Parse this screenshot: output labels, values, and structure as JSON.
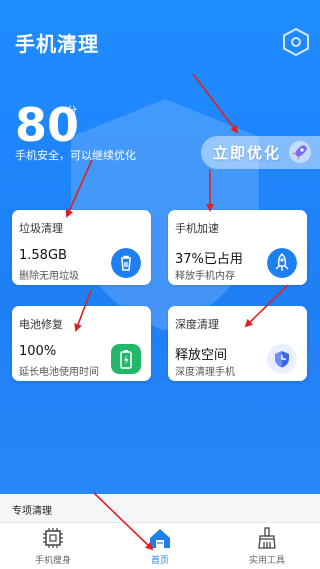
{
  "app": {
    "title": "手机清理"
  },
  "score": {
    "value": "80",
    "unit": "分",
    "status": "手机安全，可以继续优化"
  },
  "optimize_button": {
    "label": "立即优化"
  },
  "cards": [
    {
      "title": "垃圾清理",
      "value": "1.58GB",
      "subtitle": "删除无用垃圾",
      "icon": "trash-icon",
      "color": "#1e7ff0"
    },
    {
      "title": "手机加速",
      "value": "37%已占用",
      "subtitle": "释放手机内存",
      "icon": "rocket-icon",
      "color": "#1e7ff0"
    },
    {
      "title": "电池修复",
      "value": "100%",
      "subtitle": "延长电池使用时间",
      "icon": "battery-icon",
      "color": "#22b86a"
    },
    {
      "title": "深度清理",
      "value": "释放空间",
      "subtitle": "深度清理手机",
      "icon": "shield-icon",
      "color": "#e9efff"
    }
  ],
  "section": {
    "title": "专项清理"
  },
  "tabs": [
    {
      "label": "手机瘦身",
      "icon": "chip-icon",
      "active": false
    },
    {
      "label": "首页",
      "icon": "home-icon",
      "active": true
    },
    {
      "label": "实用工具",
      "icon": "brush-icon",
      "active": false
    }
  ],
  "colors": {
    "background": "#1e8cff",
    "accent": "#1e7ff0",
    "annotation": "#e02020"
  }
}
